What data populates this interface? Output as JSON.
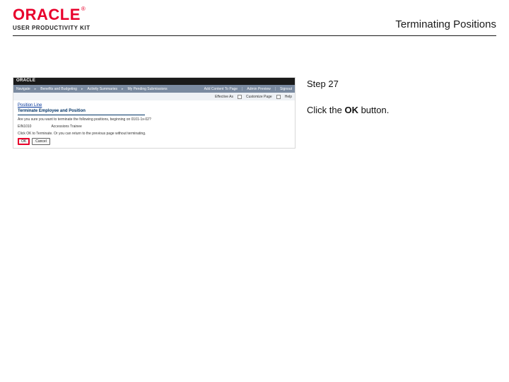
{
  "header": {
    "brand_main": "ORACLE",
    "brand_tm": "®",
    "brand_sub": "USER PRODUCTIVITY KIT",
    "page_title": "Terminating Positions"
  },
  "instruction": {
    "step_label": "Step 27",
    "text_prefix": "Click the ",
    "text_bold": "OK",
    "text_suffix": " button."
  },
  "app": {
    "topbar_brand": "ORACLE",
    "nav": {
      "item1": "Navigate",
      "item2": "Benefits and Budgeting",
      "item3": "Activity Summaries",
      "item4": "My Pending Submissions",
      "right1": "Add Content To Page",
      "right2": "Admin Preview",
      "right3": "Signout"
    },
    "subnav": {
      "effective_label": "Effective As",
      "customize_label": "Customize Page",
      "help_label": "Help"
    },
    "body": {
      "breadcrumb": "Position Line",
      "heading": "Terminate Employee and Position",
      "confirm_text": "Are you sure you want to terminate the following positions, beginning on 0101-1x-02?",
      "col1": "EIN1010",
      "col2": "Accessions Trainee",
      "hint": "Click OK to Terminate. Or you can return to the previous page without terminating.",
      "ok_label": "OK",
      "cancel_label": "Cancel"
    }
  }
}
